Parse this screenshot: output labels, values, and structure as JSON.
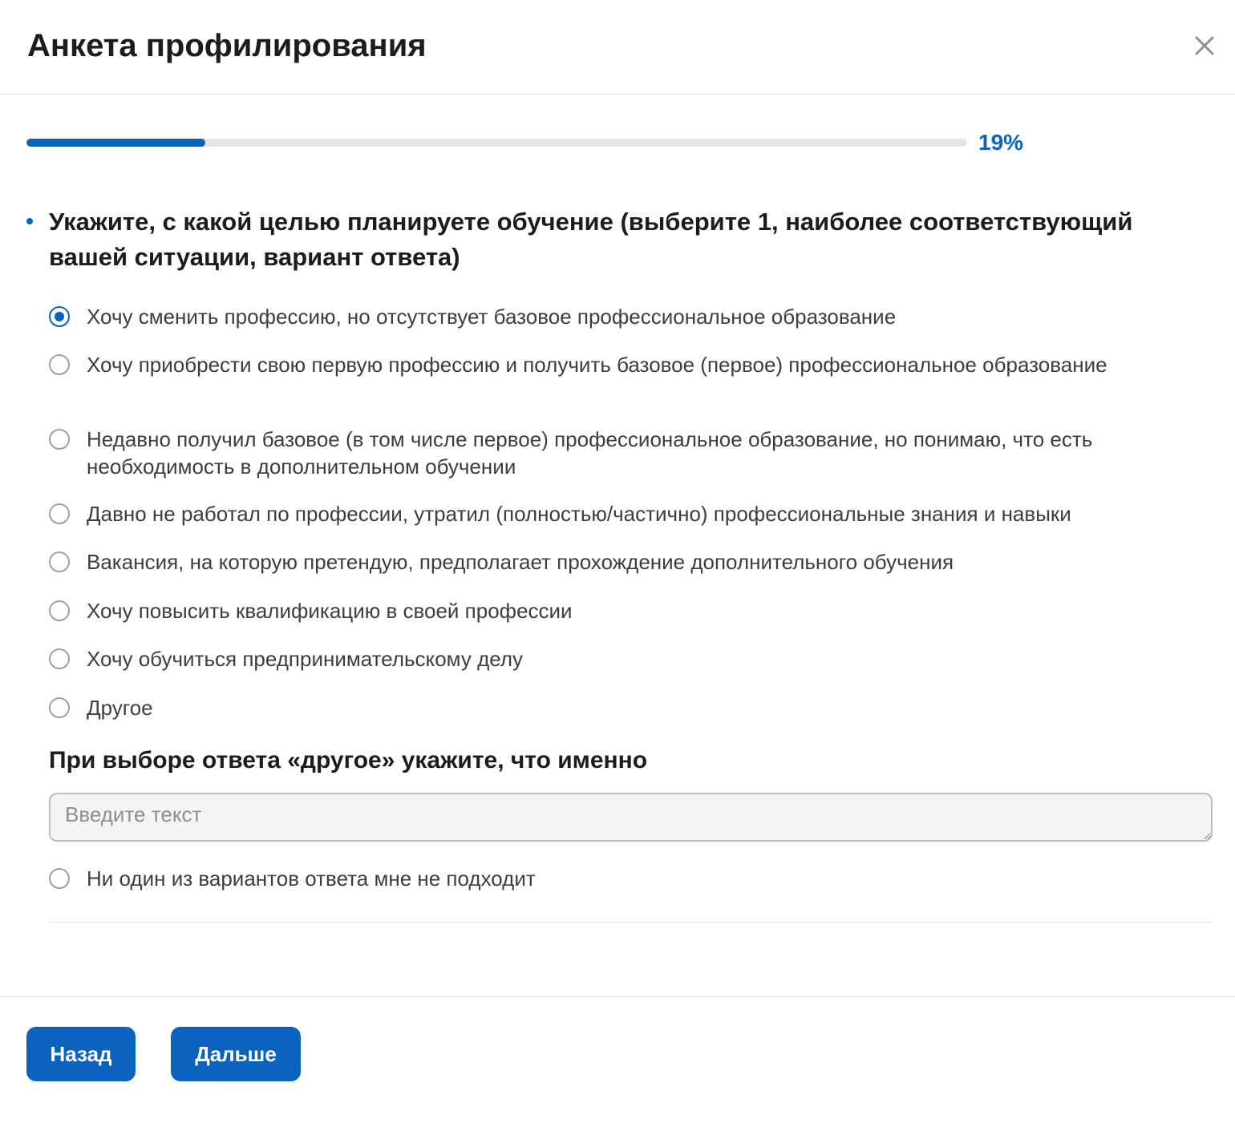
{
  "header": {
    "title": "Анкета профилирования",
    "close_icon": "close-icon"
  },
  "progress": {
    "percent": 19,
    "label": "19%"
  },
  "question": {
    "text": "Укажите, с какой целью планируете обучение (выберите 1, наиболее соответствующий вашей ситуации, вариант ответа)"
  },
  "options": [
    {
      "label": "Хочу сменить профессию, но отсутствует базовое профессиональное образование",
      "checked": true
    },
    {
      "label": "Хочу приобрести свою первую профессию и получить базовое (первое) профессиональное образование",
      "checked": false
    },
    {
      "label": "Недавно получил базовое (в том числе первое) профессиональное образование, но понимаю, что есть необходимость в дополнительном обучении",
      "checked": false
    },
    {
      "label": "Давно не работал по профессии, утратил (полностью/частично) профессиональные знания и навыки",
      "checked": false
    },
    {
      "label": "Вакансия, на которую претендую, предполагает прохождение дополнительного обучения",
      "checked": false
    },
    {
      "label": "Хочу повысить квалификацию в своей профессии",
      "checked": false
    },
    {
      "label": "Хочу обучиться предпринимательскому делу",
      "checked": false
    },
    {
      "label": "Другое",
      "checked": false
    }
  ],
  "other": {
    "title": "При выборе ответа «другое» укажите, что именно",
    "placeholder": "Введите текст",
    "value": ""
  },
  "none_option": {
    "label": "Ни один из вариантов ответа мне не подходит",
    "checked": false
  },
  "footer": {
    "back_label": "Назад",
    "next_label": "Дальше"
  },
  "colors": {
    "accent": "#0b63bf",
    "progress_track": "#e4e5e7"
  }
}
